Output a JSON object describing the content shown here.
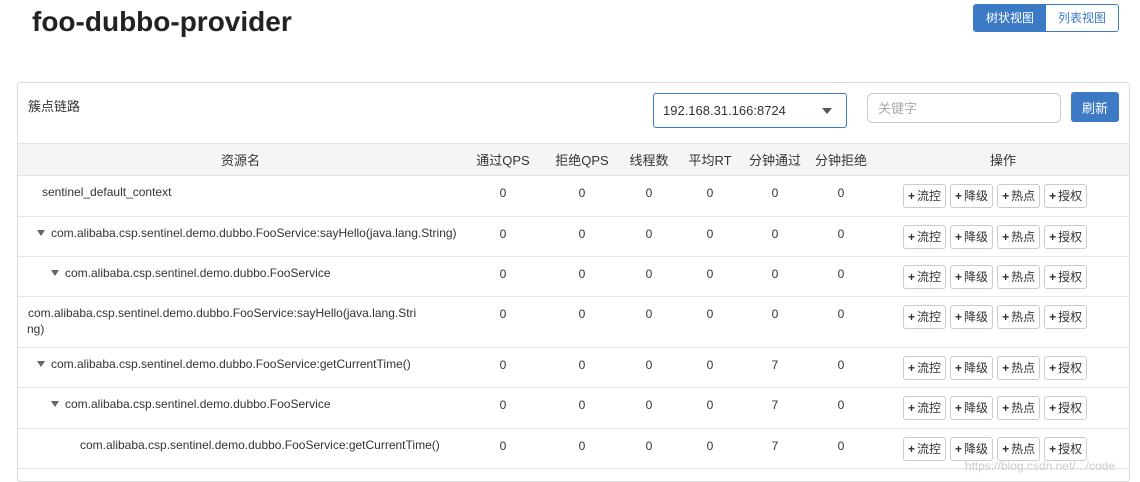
{
  "page_title": "foo-dubbo-provider",
  "view_toggle": {
    "tree": "树状视图",
    "list": "列表视图"
  },
  "panel": {
    "title": "簇点链路",
    "machine": "192.168.31.166:8724",
    "search_placeholder": "关键字",
    "refresh": "刷新"
  },
  "columns": [
    "资源名",
    "通过QPS",
    "拒绝QPS",
    "线程数",
    "平均RT",
    "分钟通过",
    "分钟拒绝",
    "操作"
  ],
  "op_labels": [
    "流控",
    "降级",
    "热点",
    "授权"
  ],
  "rows": [
    {
      "name": "sentinel_default_context",
      "name2": "",
      "expand": false,
      "values": [
        "0",
        "0",
        "0",
        "0",
        "0",
        "0"
      ]
    },
    {
      "name": "com.alibaba.csp.sentinel.demo.dubbo.FooService:sayHello(java.lang.String)",
      "name2": "",
      "expand": true,
      "values": [
        "0",
        "0",
        "0",
        "0",
        "0",
        "0"
      ]
    },
    {
      "name": "com.alibaba.csp.sentinel.demo.dubbo.FooService",
      "name2": "",
      "expand": true,
      "values": [
        "0",
        "0",
        "0",
        "0",
        "0",
        "0"
      ]
    },
    {
      "name": "com.alibaba.csp.sentinel.demo.dubbo.FooService:sayHello(java.lang.Stri",
      "name2": "ng)",
      "expand": false,
      "values": [
        "0",
        "0",
        "0",
        "0",
        "0",
        "0"
      ]
    },
    {
      "name": "com.alibaba.csp.sentinel.demo.dubbo.FooService:getCurrentTime()",
      "name2": "",
      "expand": true,
      "values": [
        "0",
        "0",
        "0",
        "0",
        "7",
        "0"
      ]
    },
    {
      "name": "com.alibaba.csp.sentinel.demo.dubbo.FooService",
      "name2": "",
      "expand": true,
      "values": [
        "0",
        "0",
        "0",
        "0",
        "7",
        "0"
      ]
    },
    {
      "name": "com.alibaba.csp.sentinel.demo.dubbo.FooService:getCurrentTime()",
      "name2": "",
      "expand": false,
      "values": [
        "0",
        "0",
        "0",
        "0",
        "7",
        "0"
      ]
    }
  ],
  "watermark": "https://blog.csdn.net/.../code"
}
